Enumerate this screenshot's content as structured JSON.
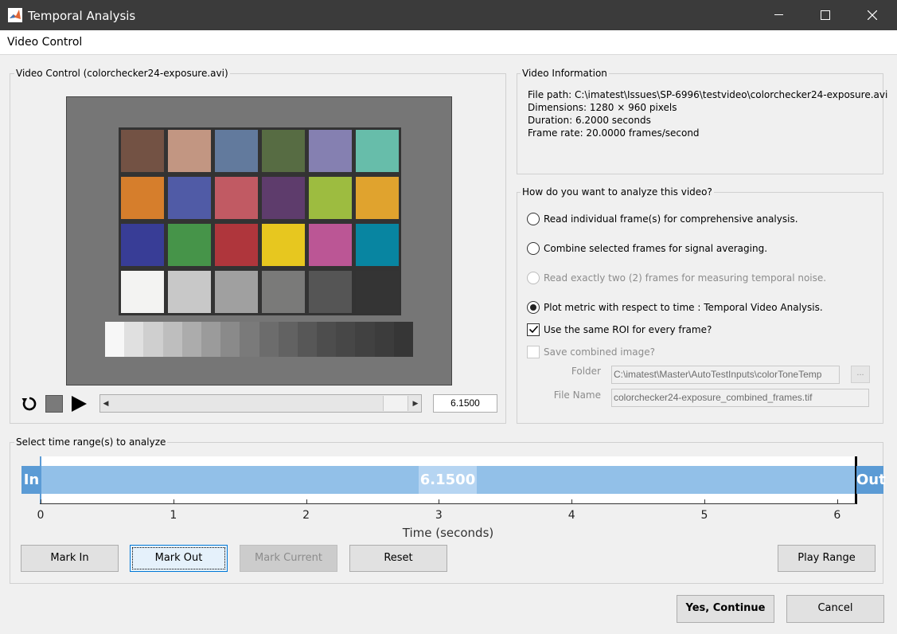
{
  "window": {
    "title": "Temporal Analysis",
    "icon": "matlab-icon"
  },
  "menu": {
    "label": "Video Control"
  },
  "video_panel": {
    "title": "Video Control (colorchecker24-exposure.avi)",
    "current_time": "6.1500",
    "checker_colors": [
      "#735244",
      "#c29682",
      "#627a9d",
      "#576c43",
      "#8580b1",
      "#67bdaa",
      "#d67e2c",
      "#505ba6",
      "#c15a63",
      "#5e3c6c",
      "#9dbc40",
      "#e0a32e",
      "#383d96",
      "#469449",
      "#af363c",
      "#e7c71f",
      "#bb5695",
      "#0885a1",
      "#f3f3f2",
      "#c8c8c8",
      "#a0a0a0",
      "#7a7a79",
      "#555555",
      "#343434"
    ],
    "gray_ramp": [
      "#f7f7f7",
      "#e0e0e0",
      "#cfcfcf",
      "#bebebe",
      "#acacac",
      "#9b9b9b",
      "#8a8a8a",
      "#7a7a7a",
      "#6c6c6c",
      "#626262",
      "#575757",
      "#4d4d4d",
      "#474747",
      "#414141",
      "#3c3c3c",
      "#363636"
    ]
  },
  "video_info": {
    "title": "Video Information",
    "file_path": "File path: C:\\imatest\\Issues\\SP-6996\\testvideo\\colorchecker24-exposure.avi",
    "dimensions": "Dimensions: 1280 × 960 pixels",
    "duration": "Duration: 6.2000 seconds",
    "frame_rate": "Frame rate: 20.0000 frames/second"
  },
  "analysis": {
    "title": "How do you want to analyze this video?",
    "options": [
      {
        "label": "Read individual frame(s) for comprehensive analysis.",
        "selected": false,
        "enabled": true
      },
      {
        "label": "Combine selected frames for signal averaging.",
        "selected": false,
        "enabled": true
      },
      {
        "label": "Read exactly two (2) frames for measuring temporal noise.",
        "selected": false,
        "enabled": false
      },
      {
        "label": "Plot metric with respect to time : Temporal Video Analysis.",
        "selected": true,
        "enabled": true
      }
    ],
    "same_roi_label": "Use the same ROI for every frame?",
    "same_roi_checked": true,
    "save_combined_label": "Save combined image?",
    "save_combined_checked": false,
    "folder_label": "Folder",
    "folder_value": "C:\\imatest\\Master\\AutoTestInputs\\colorToneTemp",
    "browse_label": "...",
    "filename_label": "File Name",
    "filename_value": "colorchecker24-exposure_combined_frames.tif"
  },
  "time_range": {
    "title": "Select time range(s) to analyze",
    "in_label": "In",
    "out_label": "Out",
    "current_label": "6.1500",
    "axis_title": "Time (seconds)",
    "ticks": [
      "0",
      "1",
      "2",
      "3",
      "4",
      "5",
      "6"
    ],
    "in_time": 0,
    "out_time": 6.15,
    "current_time": 3
  },
  "buttons": {
    "mark_in": "Mark In",
    "mark_out": "Mark Out",
    "mark_current": "Mark Current",
    "reset": "Reset",
    "play_range": "Play Range",
    "continue": "Yes, Continue",
    "cancel": "Cancel"
  }
}
